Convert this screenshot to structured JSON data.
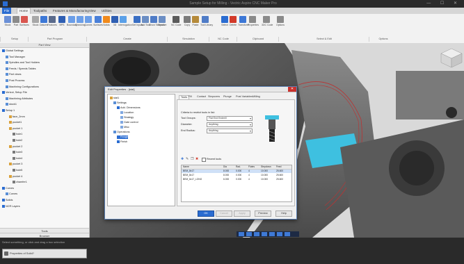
{
  "titlebar": {
    "title": "Sample Setup for Milling - Vectric Aspire CNC Maker Pro",
    "window_controls": "— ☐ ✕"
  },
  "tabs": [
    {
      "label": "File"
    },
    {
      "label": "Home"
    },
    {
      "label": "Toolpaths"
    },
    {
      "label": "Features & Manufacturing"
    },
    {
      "label": "View"
    },
    {
      "label": "Utilities"
    }
  ],
  "ribbon": {
    "buttons": [
      {
        "label": "Stock",
        "icon": "stock-icon",
        "color": "#6a8fd6"
      },
      {
        "label": "Part",
        "icon": "part-icon",
        "color": "#8a8a8a"
      },
      {
        "label": "Surfaces",
        "icon": "surfaces-icon",
        "color": "#d9564f"
      },
      {
        "label": "Stock",
        "icon": "stock2-icon",
        "color": "#a8a8a8"
      },
      {
        "label": "Datums",
        "icon": "datums-icon",
        "color": "#3d78d6"
      },
      {
        "label": "Features",
        "icon": "features-icon",
        "color": "#5a6b8c"
      },
      {
        "label": "BPS",
        "icon": "bps-icon",
        "color": "#2f5fb3"
      },
      {
        "label": "Boundary",
        "icon": "boundary-icon",
        "color": "#6b9ee8"
      },
      {
        "label": "Checking",
        "icon": "checking-icon",
        "color": "#6b9ee8"
      },
      {
        "label": "Curves",
        "icon": "curves-icon",
        "color": "#6b9ee8"
      },
      {
        "label": "Surfaces",
        "icon": "surfaces2-icon",
        "color": "#4a80d8"
      },
      {
        "label": "Solids",
        "icon": "solids-icon",
        "color": "#f08a1c"
      },
      {
        "label": "3D",
        "icon": "3d-icon",
        "color": "#2f5fb3"
      },
      {
        "label": "Interrogation",
        "icon": "interrogation-icon",
        "color": "#5aa0e8"
      },
      {
        "label": "Set Inputs",
        "icon": "setinputs-icon",
        "color": "#3a6fc4"
      },
      {
        "label": "Add Tool",
        "icon": "addtool-icon",
        "color": "#6b8ec4"
      },
      {
        "label": "Show Toolpath",
        "icon": "showtoolpath-icon",
        "color": "#4f7cc7"
      },
      {
        "label": "Remove",
        "icon": "remove-icon",
        "color": "#6b8ec4"
      },
      {
        "label": "NC Code",
        "icon": "nccode-icon",
        "color": "#5a5a5a"
      },
      {
        "label": "Copy",
        "icon": "copy-icon",
        "color": "#7a7a7a"
      },
      {
        "label": "Paste",
        "icon": "paste-icon",
        "color": "#b58a3a"
      },
      {
        "label": "Tool Library",
        "icon": "toollibrary-icon",
        "color": "#4f7cc7"
      },
      {
        "label": "Select",
        "icon": "select-icon",
        "color": "#2a6cd1"
      },
      {
        "label": "Delete",
        "icon": "delete-icon",
        "color": "#d23a2a"
      },
      {
        "label": "Transform",
        "icon": "transform-icon",
        "color": "#3d78d6"
      },
      {
        "label": "Properties",
        "icon": "properties-icon",
        "color": "#8a8a8a"
      },
      {
        "label": "3DC Code",
        "icon": "3dc-icon",
        "color": "#8a8a8a"
      },
      {
        "label": "Options",
        "icon": "options-icon",
        "color": "#8a8a8a"
      }
    ],
    "groups": [
      {
        "label": "Setup"
      },
      {
        "label": "Part Program"
      },
      {
        "label": "Create"
      },
      {
        "label": "Simulation"
      },
      {
        "label": "NC Code"
      },
      {
        "label": "Clipboard"
      },
      {
        "label": "Select & Edit"
      },
      {
        "label": "Options"
      }
    ]
  },
  "leftpanel": {
    "header": "Part View",
    "tree": [
      {
        "label": "Global Settings",
        "indent": 0
      },
      {
        "label": "Tool Manager",
        "indent": 1
      },
      {
        "label": "Spindles and Tool Holders",
        "indent": 1
      },
      {
        "label": "Feeds / Speeds Tables",
        "indent": 1
      },
      {
        "label": "Part views",
        "indent": 1
      },
      {
        "label": "Post Process",
        "indent": 1
      },
      {
        "label": "Machining Configurations",
        "indent": 1
      },
      {
        "label": "Vericut, Setup File",
        "indent": 0
      },
      {
        "label": "Machining Attributes",
        "indent": 1
      },
      {
        "label": "stock1",
        "indent": 1
      },
      {
        "label": "Setup 1",
        "indent": 0
      },
      {
        "label": "face_2mm",
        "indent": 2
      },
      {
        "label": "pocket1",
        "indent": 2
      },
      {
        "label": "pocket 1",
        "indent": 2
      },
      {
        "label": "hole1",
        "indent": 3
      },
      {
        "label": "hole2",
        "indent": 3
      },
      {
        "label": "pocket 2",
        "indent": 2
      },
      {
        "label": "hole3",
        "indent": 3
      },
      {
        "label": "hole4",
        "indent": 3
      },
      {
        "label": "pocket 3",
        "indent": 2
      },
      {
        "label": "hole5",
        "indent": 3
      },
      {
        "label": "pocket 4",
        "indent": 2
      },
      {
        "label": "chamfer1",
        "indent": 3
      },
      {
        "label": "Curves",
        "indent": 0
      },
      {
        "label": "Curves",
        "indent": 1
      },
      {
        "label": "Solids",
        "indent": 0
      },
      {
        "label": "NCR Layers",
        "indent": 0
      }
    ],
    "tools_button": "Tools",
    "browser_button": "Browser"
  },
  "status": {
    "message": "Select something, or click and drag a box selection",
    "command_label": "Properties of Solid?"
  },
  "viewport": {
    "tab_label": "Sample Setup for ..."
  },
  "dialog": {
    "title": "Edit Properties - [stat]",
    "tree": [
      {
        "label": "stat1",
        "indent": 0
      },
      {
        "label": "Settings",
        "indent": 1
      },
      {
        "label": "Add. Dimensions",
        "indent": 2
      },
      {
        "label": "Location",
        "indent": 3
      },
      {
        "label": "Strategy",
        "indent": 3
      },
      {
        "label": "Gate control",
        "indent": 3
      },
      {
        "label": "Misc",
        "indent": 3
      },
      {
        "label": "Operations",
        "indent": 1
      },
      {
        "label": "Rough",
        "indent": 2
      },
      {
        "label": "Finish",
        "indent": 2
      }
    ],
    "tabs": [
      {
        "label": "Tools"
      },
      {
        "label": "Fill"
      },
      {
        "label": "Contact"
      },
      {
        "label": "Stepovers"
      },
      {
        "label": "Plunge"
      },
      {
        "label": "Post Variables"
      },
      {
        "label": "Milling"
      }
    ],
    "criteria_label": "Criteria to restrict tools in list:",
    "fields": [
      {
        "label": "Tool Groups:",
        "value": "Flat End Endmill"
      },
      {
        "label": "Diameter:",
        "value": "Anything"
      },
      {
        "label": "End Radius:",
        "value": "Anything"
      }
    ],
    "recent_tools": "Recent tools",
    "table": {
      "headers": [
        "Name",
        "Dia",
        "Rad.",
        "Flutes",
        "Stepdown",
        "Feed"
      ],
      "rows": [
        [
          "BEM_8x17",
          "8.000",
          "0.000",
          "4",
          "10.000",
          "25.600"
        ],
        [
          "BEM_8x17",
          "8.000",
          "0.000",
          "4",
          "10.000",
          "25.600"
        ],
        [
          "BEM_6x17_LONG",
          "6.000",
          "0.000",
          "4",
          "10.000",
          "25.600"
        ]
      ]
    },
    "buttons": [
      {
        "label": "OK",
        "kind": "ok"
      },
      {
        "label": "Cancel",
        "kind": "dis"
      },
      {
        "label": "Apply",
        "kind": "dis"
      },
      {
        "label": "Preview",
        "kind": ""
      },
      {
        "label": "Help",
        "kind": ""
      }
    ]
  }
}
